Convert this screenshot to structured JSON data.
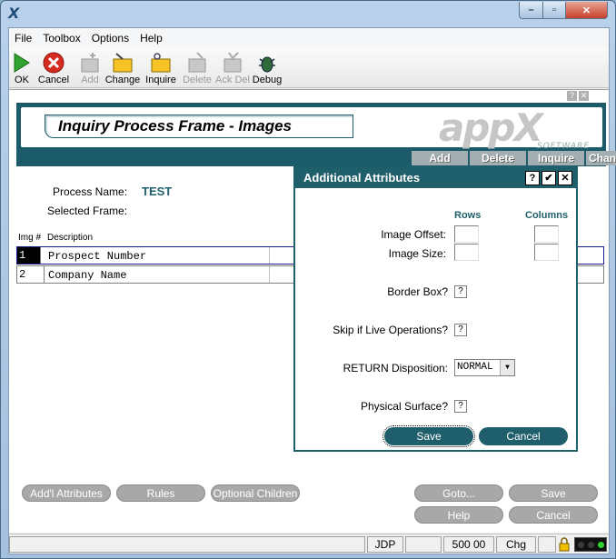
{
  "window": {
    "app_icon": "X",
    "min": "–",
    "max": "▫",
    "close": "✕"
  },
  "menu": [
    "File",
    "Toolbox",
    "Options",
    "Help"
  ],
  "toolbar": [
    {
      "label": "OK",
      "icon": "ok-arrow-icon",
      "enabled": true
    },
    {
      "label": "Cancel",
      "icon": "cancel-x-icon",
      "enabled": true
    },
    {
      "label": "Add",
      "icon": "add-icon",
      "enabled": false
    },
    {
      "label": "Change",
      "icon": "change-folder-icon",
      "enabled": true
    },
    {
      "label": "Inquire",
      "icon": "inquire-folder-icon",
      "enabled": true
    },
    {
      "label": "Delete",
      "icon": "delete-icon",
      "enabled": false
    },
    {
      "label": "Ack Del",
      "icon": "ack-delete-icon",
      "enabled": false
    },
    {
      "label": "Debug",
      "icon": "bug-icon",
      "enabled": true
    }
  ],
  "frame": {
    "help": "?",
    "close": "✕",
    "title": "Inquiry Process Frame - Images",
    "logo": "appX",
    "logo_sub": "SOFTWARE",
    "tabs": [
      "Add",
      "Delete",
      "Inquire",
      "Change"
    ]
  },
  "form": {
    "process_label": "Process Name:",
    "process_value": "TEST",
    "frame_label": "Selected Frame:",
    "col_img": "Img #",
    "col_desc": "Description",
    "rows": [
      {
        "num": "1",
        "desc": "Prospect Number"
      },
      {
        "num": "2",
        "desc": "Company Name"
      }
    ]
  },
  "buttons": {
    "attributes": "Add'l Attributes",
    "rules": "Rules",
    "children": "Optional Children",
    "goto": "Goto...",
    "save": "Save",
    "help": "Help",
    "cancel": "Cancel"
  },
  "status": {
    "user": "JDP",
    "value": "500 00",
    "mode": "Chg"
  },
  "dialog": {
    "title": "Additional Attributes",
    "help": "?",
    "ok": "✔",
    "close": "✕",
    "rows_hdr": "Rows",
    "cols_hdr": "Columns",
    "offset": "Image Offset:",
    "size": "Image Size:",
    "border": "Border Box?",
    "skip": "Skip if Live Operations?",
    "return_disp": "RETURN Disposition:",
    "return_value": "NORMAL",
    "physical": "Physical Surface?",
    "q": "?",
    "save": "Save",
    "cancel": "Cancel"
  }
}
